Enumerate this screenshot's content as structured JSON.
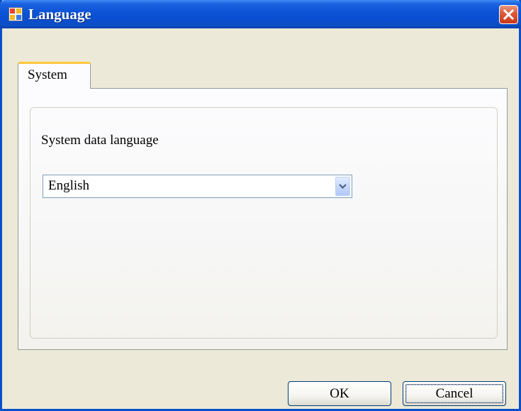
{
  "window": {
    "title": "Language",
    "icon": "app-window-icon",
    "close_icon": "close-icon"
  },
  "tabs": [
    {
      "label": "System",
      "selected": true
    }
  ],
  "panel": {
    "field_label": "System data language",
    "language_select": {
      "value": "English",
      "icon": "chevron-down-icon"
    }
  },
  "buttons": {
    "ok_label": "OK",
    "cancel_label": "Cancel"
  },
  "colors": {
    "titlebar": "#0a53d6",
    "window_border": "#0a50c8",
    "dialog_background": "#ece9d8",
    "tab_highlight": "#ffc83c",
    "close_button": "#dd5c3a"
  }
}
